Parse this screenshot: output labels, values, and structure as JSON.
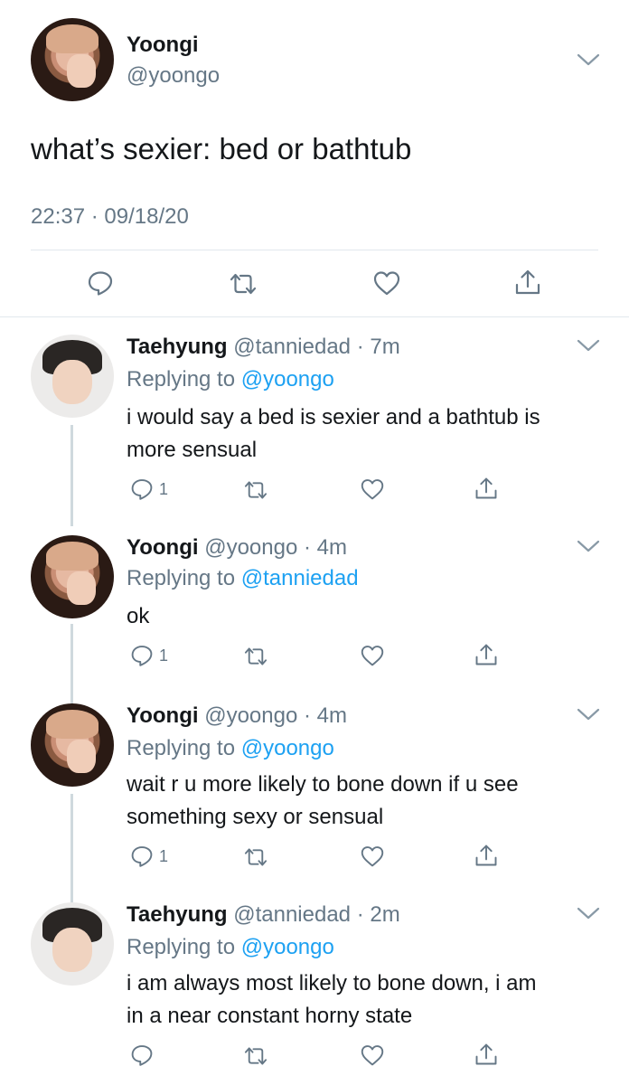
{
  "main_tweet": {
    "name": "Yoongi",
    "handle": "@yoongo",
    "text": "what’s sexier: bed or bathtub",
    "timestamp": "22:37 · 09/18/20"
  },
  "replies": [
    {
      "name": "Taehyung",
      "handle": "@tanniedad",
      "time": "· 7m",
      "replying_prefix": "Replying to ",
      "replying_to": "@yoongo",
      "text_lines": [
        "i would say a bed is sexier and a bathtub is",
        "more sensual"
      ],
      "reply_count": "1"
    },
    {
      "name": "Yoongi",
      "handle": "@yoongo",
      "time": "· 4m",
      "replying_prefix": "Replying to ",
      "replying_to": "@tanniedad",
      "text_lines": [
        "ok"
      ],
      "reply_count": "1"
    },
    {
      "name": "Yoongi",
      "handle": "@yoongo",
      "time": "· 4m",
      "replying_prefix": "Replying to ",
      "replying_to": "@yoongo",
      "text_lines": [
        "wait r u more likely to bone down if u see",
        "something sexy or sensual"
      ],
      "reply_count": "1"
    },
    {
      "name": "Taehyung",
      "handle": "@tanniedad",
      "time": "· 2m",
      "replying_prefix": "Replying to ",
      "replying_to": "@yoongo",
      "text_lines": [
        "i am always most likely to bone down, i am",
        "in a near constant horny state"
      ],
      "reply_count": ""
    }
  ],
  "icons": [
    "reply-icon",
    "retweet-icon",
    "like-icon",
    "share-icon",
    "chevron-down-icon"
  ],
  "colors": {
    "link": "#1da1f2",
    "secondary_text": "#657786",
    "divider": "#e1e8ed",
    "icon": "#657786"
  }
}
